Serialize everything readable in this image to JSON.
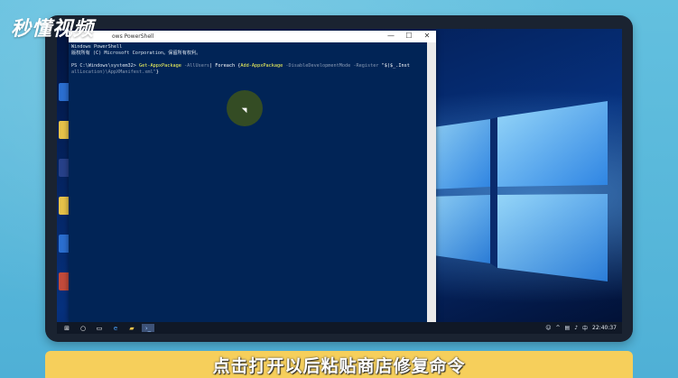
{
  "logo": "秒懂视频",
  "caption": "点击打开以后粘贴商店修复命令",
  "powershell": {
    "title": "Windows PowerShell",
    "title_prefix": "ows PowerShell",
    "controls": {
      "minimize": "—",
      "maximize": "☐",
      "close": "✕"
    },
    "lines": {
      "l1": "Windows PowerShell",
      "l2": "版权所有 (C) Microsoft Corporation。保留所有权利。",
      "prompt": "PS C:\\Windows\\system32> ",
      "cmd_a": "Get-AppxPackage",
      "cmd_b": " -AllUsers",
      "cmd_c": "| Foreach {",
      "cmd_d": "Add-AppxPackage",
      "cmd_e": " -DisableDevelopmentMode -Register ",
      "cmd_f": "\"$($_.Inst",
      "cmd_g": "allLocation)\\AppXManifest.xml\"",
      "cmd_h": "}"
    }
  },
  "desktop_icons": [
    "Micr E",
    "文",
    "Vi Visi",
    "Micr",
    "Vi offic",
    "开文 日22"
  ],
  "taskbar": {
    "clock": "22:40:37",
    "items": [
      "windows-start",
      "search",
      "task-view",
      "edge",
      "file-explorer",
      "powershell"
    ]
  },
  "colors": {
    "ps_bg": "#012456",
    "accent_yellow": "#f6cf5b",
    "taskbar": "#101826"
  }
}
